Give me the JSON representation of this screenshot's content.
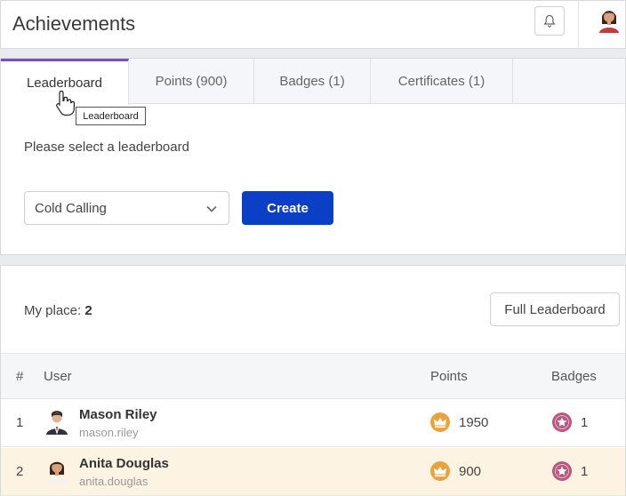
{
  "header": {
    "title": "Achievements",
    "bell_icon": "bell-icon",
    "avatar_icon": "user-avatar"
  },
  "tabs": [
    {
      "label": "Leaderboard",
      "active": true
    },
    {
      "label": "Points (900)",
      "active": false
    },
    {
      "label": "Badges (1)",
      "active": false
    },
    {
      "label": "Certificates (1)",
      "active": false
    }
  ],
  "tooltip": "Leaderboard",
  "leaderboard_form": {
    "prompt": "Please select a leaderboard",
    "selected": "Cold Calling",
    "create_label": "Create"
  },
  "summary": {
    "my_place_label": "My place:",
    "my_place_value": "2",
    "full_leaderboard_label": "Full Leaderboard"
  },
  "table": {
    "headers": {
      "rank": "#",
      "user": "User",
      "points": "Points",
      "badges": "Badges"
    },
    "rows": [
      {
        "rank": "1",
        "name": "Mason Riley",
        "username": "mason.riley",
        "points": "1950",
        "badges": "1"
      },
      {
        "rank": "2",
        "name": "Anita Douglas",
        "username": "anita.douglas",
        "points": "900",
        "badges": "1"
      }
    ]
  },
  "colors": {
    "accent": "#7b4cc9",
    "primary_button": "#0b3fc6",
    "highlight_row": "#fdf3e3",
    "points_icon": "#e8a33c",
    "badge_icon": "#b8577f"
  }
}
